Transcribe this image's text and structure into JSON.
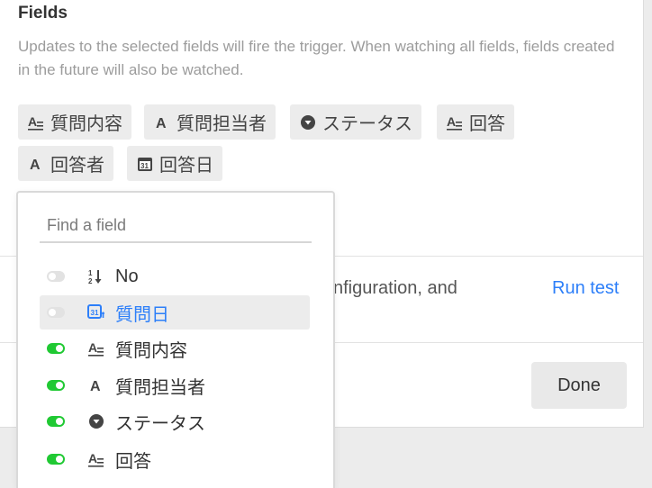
{
  "section": {
    "title": "Fields",
    "help": "Updates to the selected fields will fire the trigger. When watching all fields, fields created in the future will also be watched."
  },
  "chips": [
    {
      "label": "質問内容",
      "icon": "long-text-icon"
    },
    {
      "label": "質問担当者",
      "icon": "single-line-text-icon"
    },
    {
      "label": "ステータス",
      "icon": "single-select-icon"
    },
    {
      "label": "回答",
      "icon": "long-text-icon"
    },
    {
      "label": "回答者",
      "icon": "single-line-text-icon"
    },
    {
      "label": "回答日",
      "icon": "date-icon"
    }
  ],
  "background": {
    "config_text": "nfiguration, and",
    "run_test": "Run test",
    "done": "Done"
  },
  "dropdown": {
    "placeholder": "Find a field",
    "items": [
      {
        "label": "No",
        "enabled": false,
        "icon": "autonumber-icon"
      },
      {
        "label": "質問日",
        "enabled": false,
        "icon": "created-time-icon",
        "highlighted": true
      },
      {
        "label": "質問内容",
        "enabled": true,
        "icon": "long-text-icon"
      },
      {
        "label": "質問担当者",
        "enabled": true,
        "icon": "single-line-text-icon"
      },
      {
        "label": "ステータス",
        "enabled": true,
        "icon": "single-select-icon"
      },
      {
        "label": "回答",
        "enabled": true,
        "icon": "long-text-icon"
      }
    ]
  },
  "colors": {
    "accent": "#2d7ff9",
    "toggle_on": "#20c933",
    "toggle_off": "#e2e2e2"
  }
}
